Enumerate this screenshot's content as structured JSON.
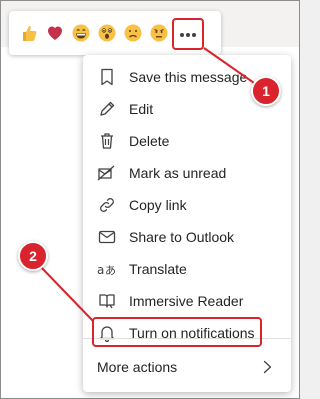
{
  "reactions": [
    {
      "icon": "thumbs-up-icon"
    },
    {
      "icon": "heart-icon"
    },
    {
      "icon": "laughing-face-icon"
    },
    {
      "icon": "surprised-face-icon"
    },
    {
      "icon": "sad-face-icon"
    },
    {
      "icon": "angry-face-icon"
    }
  ],
  "more_button": {
    "icon": "more-options-icon"
  },
  "menu": {
    "items": [
      {
        "label": "Save this message",
        "icon": "bookmark-icon"
      },
      {
        "label": "Edit",
        "icon": "pencil-icon"
      },
      {
        "label": "Delete",
        "icon": "trash-icon"
      },
      {
        "label": "Mark as unread",
        "icon": "mark-unread-icon"
      },
      {
        "label": "Copy link",
        "icon": "link-icon"
      },
      {
        "label": "Share to Outlook",
        "icon": "mail-icon"
      },
      {
        "label": "Translate",
        "icon": "translate-icon"
      },
      {
        "label": "Immersive Reader",
        "icon": "immersive-reader-icon"
      },
      {
        "label": "Turn on notifications",
        "icon": "bell-icon"
      }
    ],
    "more_actions": {
      "label": "More actions",
      "icon": "chevron-right-icon"
    }
  },
  "callouts": [
    {
      "number": "1"
    },
    {
      "number": "2"
    }
  ],
  "colors": {
    "accent": "#d9232d",
    "heart": "#c4314b",
    "emoji": "#f8c146"
  }
}
